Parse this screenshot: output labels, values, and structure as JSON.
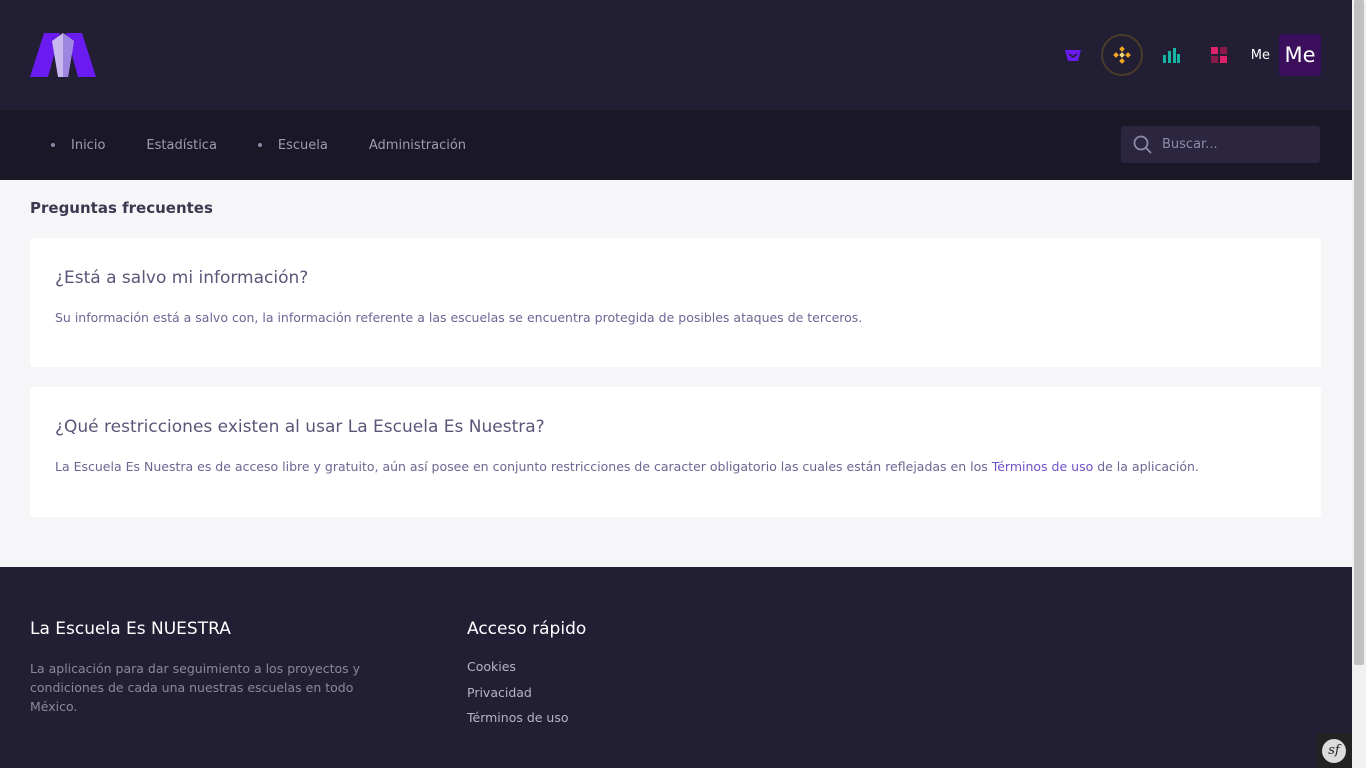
{
  "header": {
    "user_short": "Me",
    "avatar_initials": "Me"
  },
  "nav": {
    "items": [
      {
        "label": "Inicio",
        "bullet": true
      },
      {
        "label": "Estadística",
        "bullet": false
      },
      {
        "label": "Escuela",
        "bullet": true
      },
      {
        "label": "Administración",
        "bullet": false
      }
    ],
    "search_placeholder": "Buscar..."
  },
  "main": {
    "title": "Preguntas frecuentes",
    "faqs": [
      {
        "question": "¿Está a salvo mi información?",
        "answer": "Su información está a salvo con, la información referente a las escuelas se encuentra protegida de posibles ataques de terceros."
      },
      {
        "question": "¿Qué restricciones existen al usar La Escuela Es Nuestra?",
        "answer_before": "La Escuela Es Nuestra es de acceso libre y gratuito, aún así posee en conjunto restricciones de caracter obligatorio las cuales están reflejadas en los ",
        "answer_link": "Términos de uso",
        "answer_after": " de la aplicación."
      }
    ]
  },
  "footer": {
    "brand_title": "La Escuela Es NUESTRA",
    "brand_description": "La aplicación para dar seguimiento a los proyectos y condiciones de cada una nuestras escuelas en todo México.",
    "quick_title": "Acceso rápido",
    "links": [
      "Cookies",
      "Privacidad",
      "Términos de uso"
    ]
  },
  "debug_badge": "sf",
  "colors": {
    "header_bg": "#221e33",
    "nav_bg": "#1a1727",
    "accent": "#6e52c8",
    "logo_purple": "#6a1cf0"
  },
  "icons": [
    "logo",
    "basket-icon",
    "diamond-icon",
    "bar-chart-icon",
    "grid-icon",
    "search-icon",
    "symfony-icon"
  ]
}
